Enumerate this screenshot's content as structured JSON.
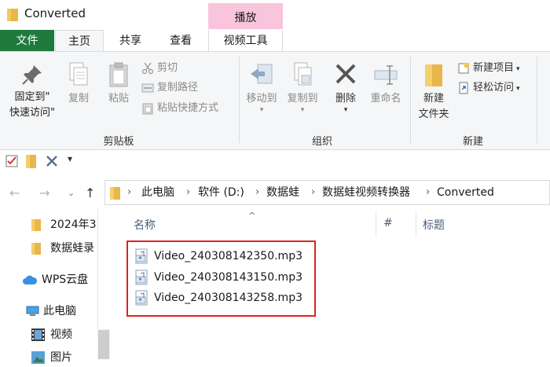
{
  "window": {
    "title": "Converted"
  },
  "tabs": {
    "file": "文件",
    "home": "主页",
    "share": "共享",
    "view": "查看",
    "context_header": "播放",
    "video_tools": "视频工具"
  },
  "ribbon": {
    "clipboard": {
      "pin_line1": "固定到\"",
      "pin_line2": "快速访问\"",
      "copy": "复制",
      "paste": "粘贴",
      "cut": "剪切",
      "copy_path": "复制路径",
      "paste_shortcut": "粘贴快捷方式",
      "group_label": "剪贴板"
    },
    "organize": {
      "move_to": "移动到",
      "copy_to": "复制到",
      "delete": "删除",
      "rename": "重命名",
      "group_label": "组织"
    },
    "new": {
      "new_folder_line1": "新建",
      "new_folder_line2": "文件夹",
      "new_item": "新建项目",
      "easy_access": "轻松访问",
      "group_label": "新建"
    }
  },
  "address": {
    "crumbs": [
      "此电脑",
      "软件 (D:)",
      "数据蛙",
      "数据蛙视频转换器",
      "Converted"
    ]
  },
  "navpane": {
    "items": [
      "2024年3",
      "数据蛙录",
      "WPS云盘",
      "此电脑",
      "视频",
      "图片"
    ]
  },
  "columns": {
    "name": "名称",
    "number": "#",
    "title": "标题"
  },
  "files": [
    "Video_240308142350.mp3",
    "Video_240308143150.mp3",
    "Video_240308143258.mp3"
  ],
  "colors": {
    "file_tab": "#1f7a3e",
    "context_tab": "#f8c5dd",
    "highlight": "#e0231e"
  }
}
